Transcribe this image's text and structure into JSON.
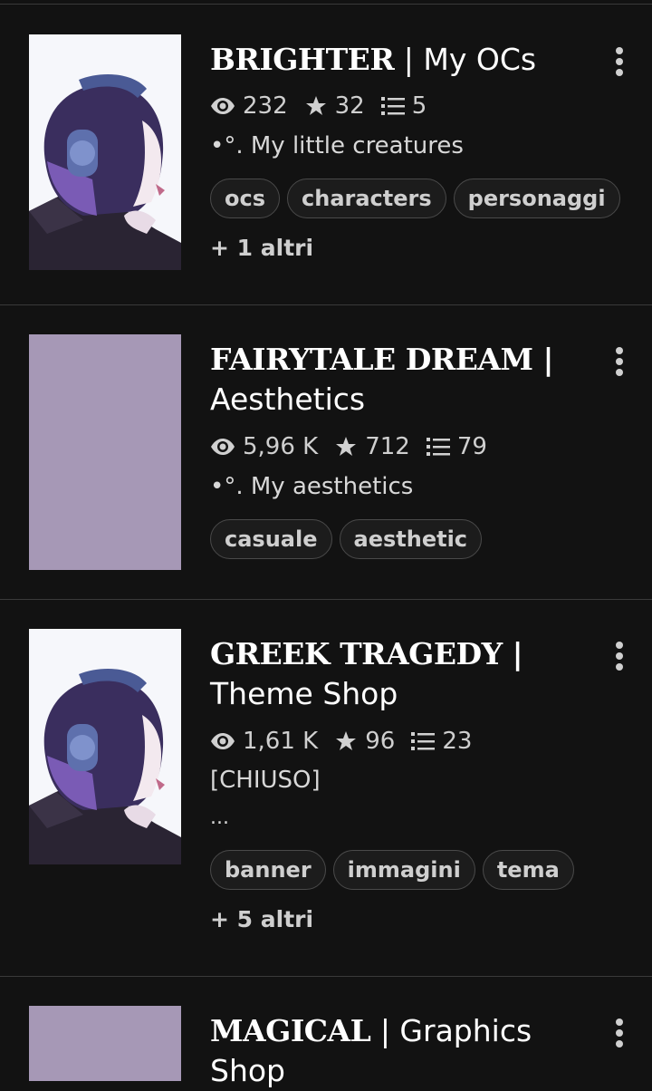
{
  "stories": [
    {
      "title_caps": "BRIGHTER",
      "title_rest": " | My OCs",
      "views": "232",
      "votes": "32",
      "parts": "5",
      "description": "•°. My little creatures",
      "tags": [
        "ocs",
        "characters",
        "personaggi"
      ],
      "more_tags": "+ 1 altri",
      "cover": "art"
    },
    {
      "title_caps": "FAIRYTALE DREAM |",
      "title_rest": "Aesthetics",
      "views": "5,96 K",
      "votes": "712",
      "parts": "79",
      "description": "•°. My aesthetics",
      "tags": [
        "casuale",
        "aesthetic"
      ],
      "more_tags": "",
      "cover": "plain"
    },
    {
      "title_caps": "GREEK TRAGEDY |",
      "title_rest": "Theme Shop",
      "views": "1,61 K",
      "votes": "96",
      "parts": "23",
      "description": "[CHIUSO]",
      "description_extra": "...",
      "tags": [
        "banner",
        "immagini",
        "tema"
      ],
      "more_tags": "+ 5 altri",
      "cover": "art"
    },
    {
      "title_caps": "MAGICAL",
      "title_rest": " | Graphics",
      "title_line2": "Shop",
      "cover": "plain"
    }
  ],
  "icons": {
    "views": "eye-icon",
    "votes": "star-icon",
    "parts": "list-icon",
    "menu": "more-vertical-icon"
  },
  "colors": {
    "background": "#121212",
    "plain_cover": "#a698b6",
    "text": "#ffffff",
    "muted": "#cfcfcf"
  }
}
